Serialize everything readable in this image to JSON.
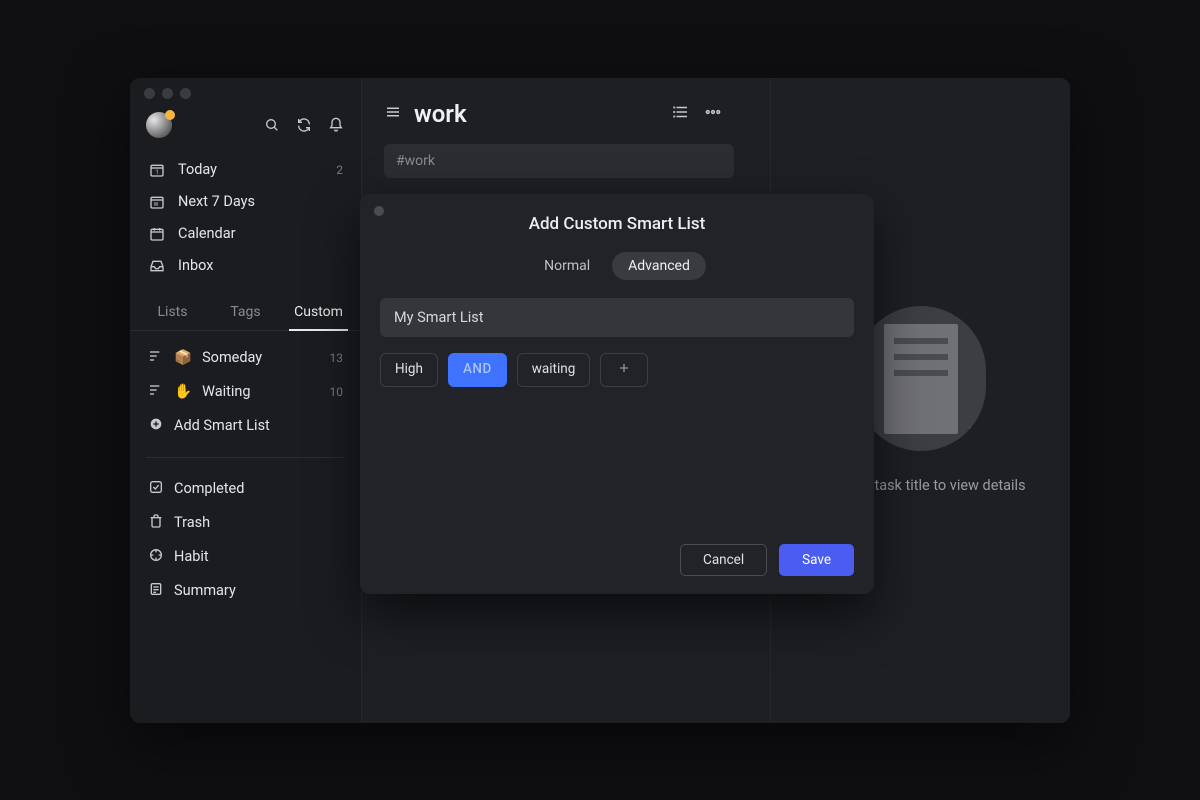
{
  "sidebar": {
    "nav": [
      {
        "label": "Today",
        "count": "2"
      },
      {
        "label": "Next 7 Days",
        "count": ""
      },
      {
        "label": "Calendar",
        "count": ""
      },
      {
        "label": "Inbox",
        "count": ""
      }
    ],
    "tabs": [
      "Lists",
      "Tags",
      "Custom"
    ],
    "active_tab": 2,
    "smart_lists": [
      {
        "emoji": "📦",
        "label": "Someday",
        "count": "13"
      },
      {
        "emoji": "✋",
        "label": "Waiting",
        "count": "10"
      }
    ],
    "add_label": "Add Smart List",
    "bottom": [
      {
        "label": "Completed"
      },
      {
        "label": "Trash"
      },
      {
        "label": "Habit"
      },
      {
        "label": "Summary"
      }
    ]
  },
  "main": {
    "title": "work",
    "search_placeholder": "#work"
  },
  "detail": {
    "text": "Click the task title to view details"
  },
  "modal": {
    "title": "Add Custom Smart List",
    "segments": [
      "Normal",
      "Advanced"
    ],
    "active_segment": 1,
    "name_value": "My Smart List",
    "chips": [
      {
        "text": "High",
        "kind": "tag"
      },
      {
        "text": "AND",
        "kind": "op"
      },
      {
        "text": "waiting",
        "kind": "tag"
      }
    ],
    "cancel": "Cancel",
    "save": "Save"
  }
}
